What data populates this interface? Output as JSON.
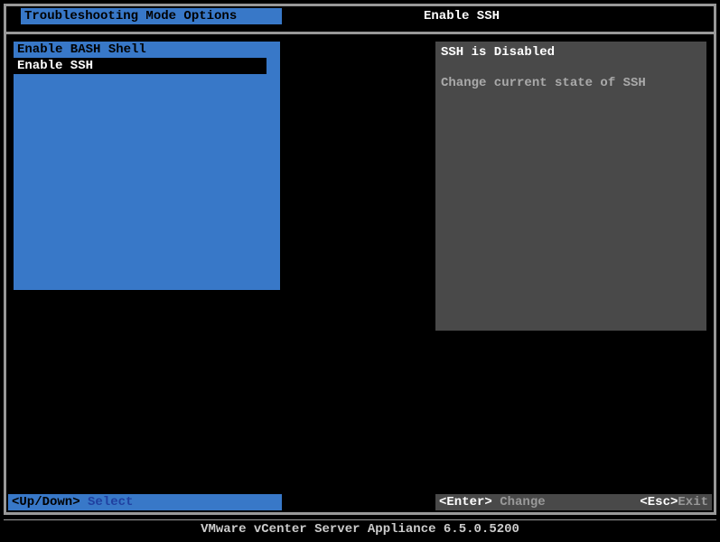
{
  "header": {
    "screen_title": "Troubleshooting Mode Options",
    "selected_title": "Enable SSH"
  },
  "menu": {
    "items": [
      {
        "label": "Enable BASH Shell",
        "selected": false
      },
      {
        "label": "Enable SSH",
        "selected": true
      }
    ]
  },
  "description": {
    "status": "SSH is Disabled",
    "text": "Change current state of SSH"
  },
  "footer": {
    "nav_key": "<Up/Down>",
    "nav_label": " Select",
    "enter_key": "<Enter>",
    "enter_label": " Change",
    "esc_key": "<Esc>",
    "esc_label": "Exit"
  },
  "product": "VMware vCenter Server Appliance 6.5.0.5200"
}
